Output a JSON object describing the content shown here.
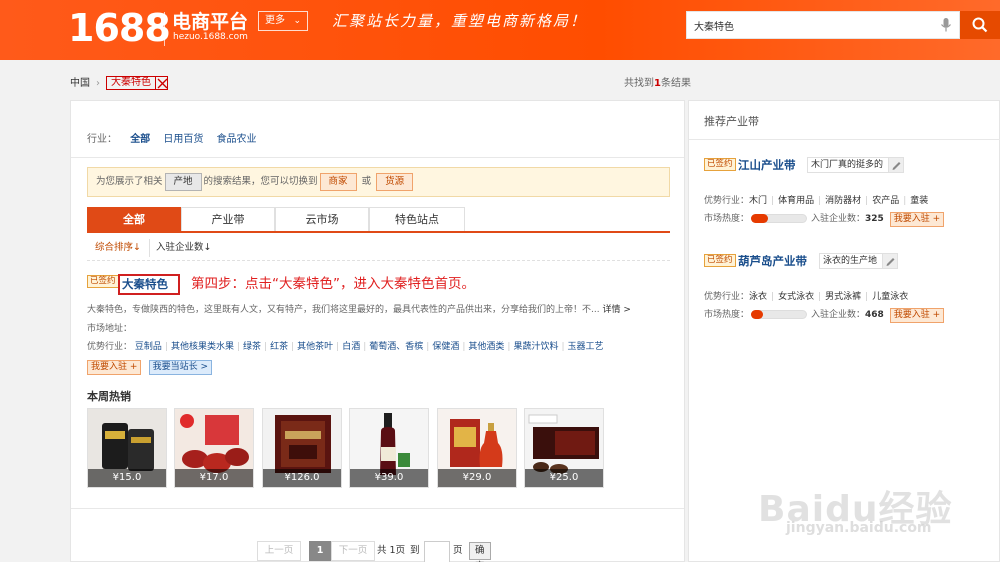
{
  "header": {
    "logo": "1688",
    "title": "电商平台",
    "subtitle": "hezuo.1688.com",
    "more_label": "更多",
    "slogan": "汇聚站长力量，重塑电商新格局！",
    "search_value": "大秦特色",
    "brand_color": "#ff5a1a"
  },
  "breadcrumb": {
    "root": "中国",
    "tag": "大秦特色",
    "result_prefix": "共找到",
    "result_count": "1",
    "result_suffix": "条结果"
  },
  "filters": {
    "label": "行业：",
    "items": [
      "全部",
      "日用百货",
      "食品农业"
    ]
  },
  "notice": {
    "prefix": "为您展示了相关",
    "btn1": "产地",
    "middle": "的搜索结果，您可以切换到",
    "btn2": "商家",
    "or": "或",
    "btn3": "货源"
  },
  "tabs": [
    "全部",
    "产业带",
    "云市场",
    "特色站点"
  ],
  "sort": [
    "综合排序↓",
    "入驻企业数↓"
  ],
  "entry": {
    "signed": "已签约",
    "name": "大秦特色",
    "step": "第四步：点击“大秦特色”，进入大秦特色首页。",
    "desc": "大秦特色，专做陕西的特色，这里既有人文，又有特产，我们将这里最好的，最具代表性的产品供出来，分享给我们的上帝！不...",
    "more": "详情 >",
    "market_label": "市场地址：",
    "adv_label": "优势行业：",
    "advantages": [
      "豆制品",
      "其他核果类水果",
      "绿茶",
      "红茶",
      "其他茶叶",
      "白酒",
      "葡萄酒、香槟",
      "保健酒",
      "其他酒类",
      "果蔬汁饮料",
      "玉器工艺"
    ],
    "btn_join": "我要入驻 +",
    "btn_owner": "我要当站长 >"
  },
  "hot": {
    "title": "本周热销",
    "products": [
      {
        "price": "¥15.0"
      },
      {
        "price": "¥17.0"
      },
      {
        "price": "¥126.0"
      },
      {
        "price": "¥39.0"
      },
      {
        "price": "¥29.0"
      },
      {
        "price": "¥25.0"
      }
    ]
  },
  "pager": {
    "prev": "上一页",
    "current": "1",
    "next": "下一页",
    "total": "共 1页",
    "goto": "到",
    "page_unit": "页",
    "ok": "确定"
  },
  "side": {
    "title": "推荐产业带",
    "belts": [
      {
        "signed": "已签约",
        "name": "江山产业带",
        "note": "木门厂真的挺多的",
        "adv_label": "优势行业：",
        "industries": [
          "木门",
          "体育用品",
          "消防器材",
          "农产品",
          "童装"
        ],
        "heat_label": "市场热度：",
        "heat_level": 0.3,
        "count_label": "入驻企业数：",
        "count": "325",
        "join": "我要入驻 +"
      },
      {
        "signed": "已签约",
        "name": "葫芦岛产业带",
        "note": "泳衣的生产地",
        "adv_label": "优势行业：",
        "industries": [
          "泳衣",
          "女式泳衣",
          "男式泳裤",
          "儿童泳衣"
        ],
        "heat_label": "市场热度：",
        "heat_level": 0.12,
        "count_label": "入驻企业数：",
        "count": "468",
        "join": "我要入驻 +"
      }
    ]
  },
  "watermark": {
    "brand": "Baidu经验",
    "url": "jingyan.baidu.com"
  }
}
